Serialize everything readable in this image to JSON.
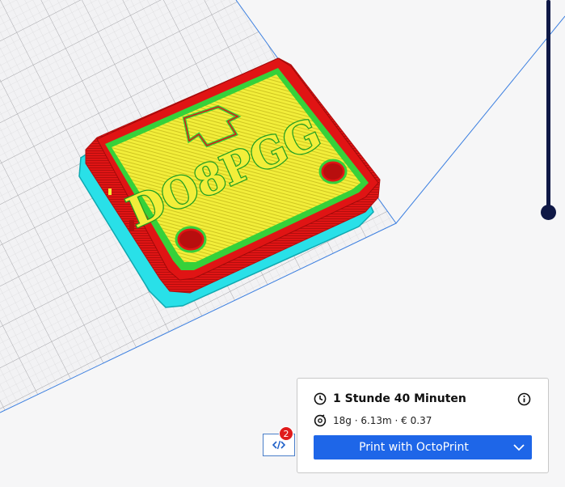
{
  "viewport": {
    "model_text": "DO8PGG"
  },
  "messages": {
    "count": "2",
    "icon": "code-icon"
  },
  "job": {
    "time": "1 Stunde 40 Minuten",
    "material": "18g · 6.13m · € 0.37",
    "icons": [
      "clock-icon",
      "spool-icon",
      "info-icon",
      "chevron-down-icon"
    ]
  },
  "print": {
    "label": "Print with OctoPrint"
  },
  "colors": {
    "accent": "#1e66e8",
    "badge": "#e01b1b",
    "wall": "#e01414",
    "infill": "#f2ee3a",
    "inner_wall": "#36d13a",
    "skirt": "#29e0e8",
    "slider": "#0f1846"
  }
}
